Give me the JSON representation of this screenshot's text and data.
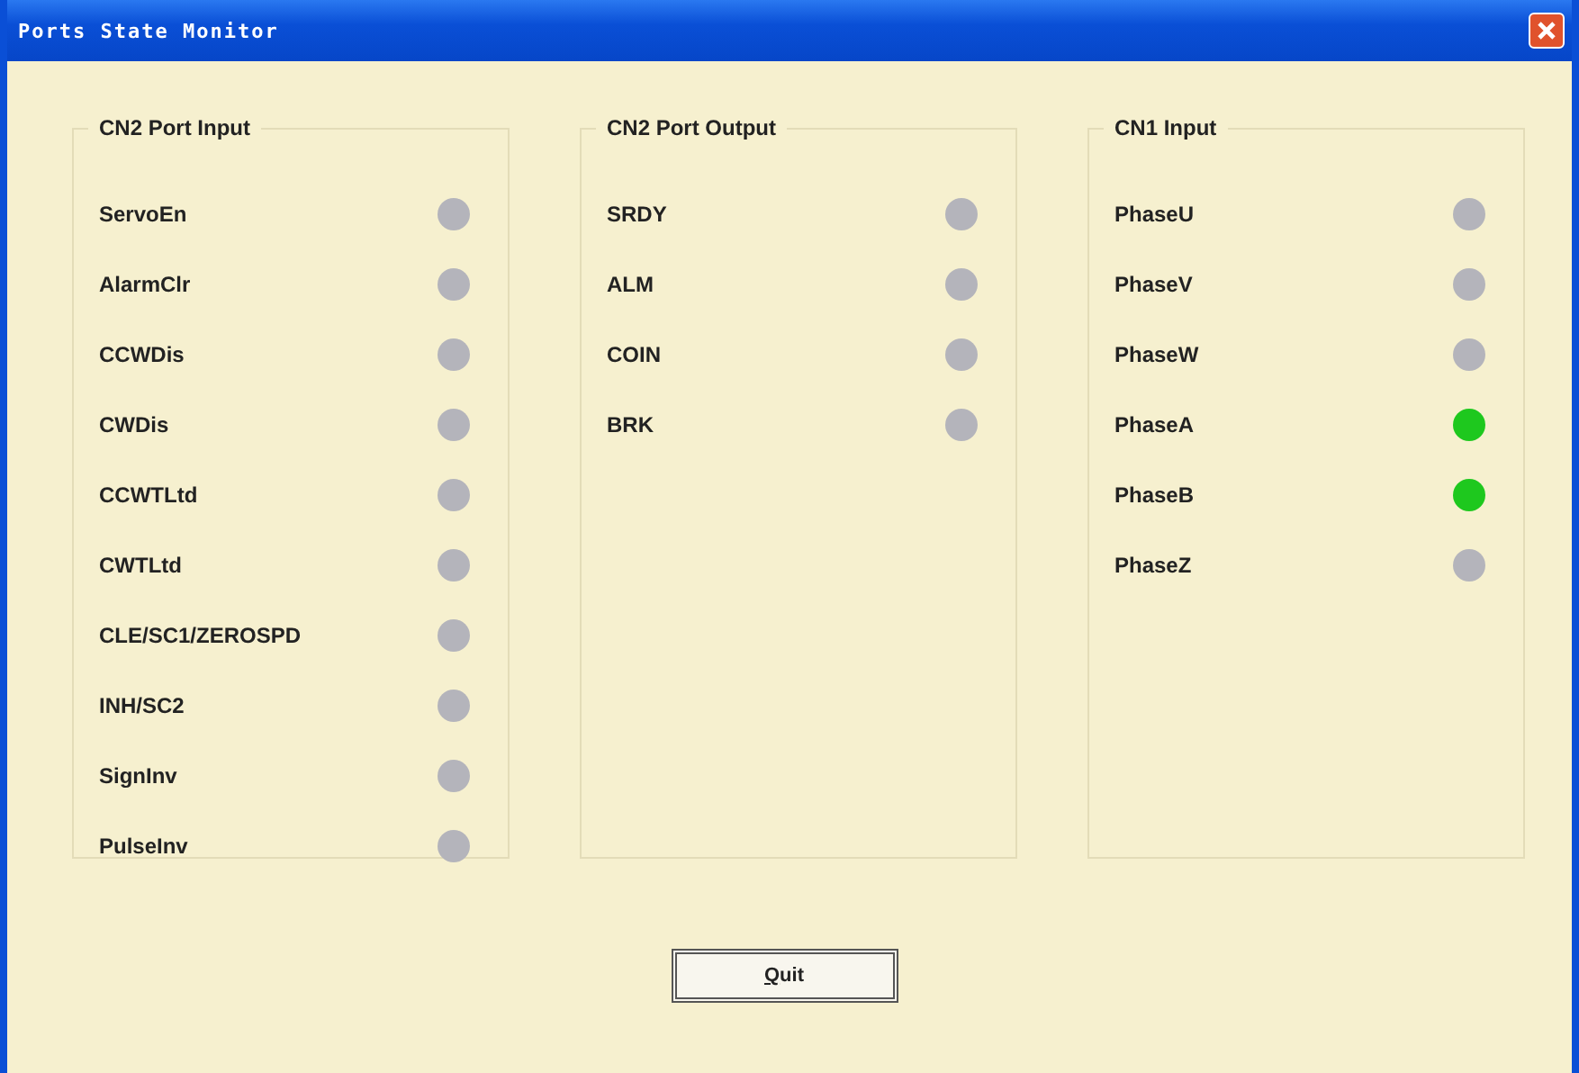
{
  "window": {
    "title": "Ports State Monitor"
  },
  "groups": [
    {
      "title": "CN2 Port Input",
      "ports": [
        {
          "name": "ServoEn",
          "on": false
        },
        {
          "name": "AlarmClr",
          "on": false
        },
        {
          "name": "CCWDis",
          "on": false
        },
        {
          "name": "CWDis",
          "on": false
        },
        {
          "name": "CCWTLtd",
          "on": false
        },
        {
          "name": "CWTLtd",
          "on": false
        },
        {
          "name": "CLE/SC1/ZEROSPD",
          "on": false
        },
        {
          "name": "INH/SC2",
          "on": false
        },
        {
          "name": "SignInv",
          "on": false
        },
        {
          "name": "PulseInv",
          "on": false
        }
      ]
    },
    {
      "title": "CN2 Port Output",
      "ports": [
        {
          "name": "SRDY",
          "on": false
        },
        {
          "name": "ALM",
          "on": false
        },
        {
          "name": "COIN",
          "on": false
        },
        {
          "name": "BRK",
          "on": false
        }
      ]
    },
    {
      "title": "CN1 Input",
      "ports": [
        {
          "name": "PhaseU",
          "on": false
        },
        {
          "name": "PhaseV",
          "on": false
        },
        {
          "name": "PhaseW",
          "on": false
        },
        {
          "name": "PhaseA",
          "on": true
        },
        {
          "name": "PhaseB",
          "on": true
        },
        {
          "name": "PhaseZ",
          "on": false
        }
      ]
    }
  ],
  "quit_button": {
    "label": "Quit",
    "mnemonic_underlined": true
  }
}
